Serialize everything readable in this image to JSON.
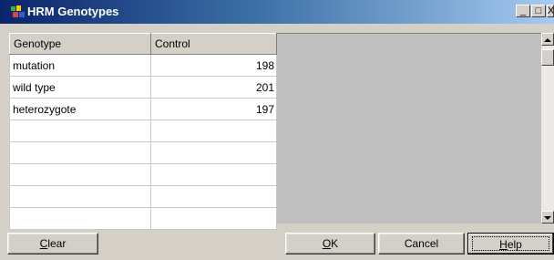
{
  "window": {
    "title": "HRM Genotypes",
    "controls": {
      "minimize": "_",
      "maximize": "□",
      "close": "X"
    }
  },
  "table": {
    "headers": [
      "Genotype",
      "Control"
    ],
    "rows": [
      [
        "mutation",
        "198"
      ],
      [
        "wild type",
        "201"
      ],
      [
        "heterozygote",
        "197"
      ],
      [
        "",
        ""
      ],
      [
        "",
        ""
      ],
      [
        "",
        ""
      ],
      [
        "",
        ""
      ],
      [
        "",
        ""
      ]
    ]
  },
  "buttons": {
    "clear": {
      "mnemonic": "C",
      "rest": "lear"
    },
    "ok": {
      "mnemonic": "O",
      "rest": "K"
    },
    "cancel": "Cancel",
    "help": {
      "mnemonic": "H",
      "rest": "elp"
    }
  }
}
